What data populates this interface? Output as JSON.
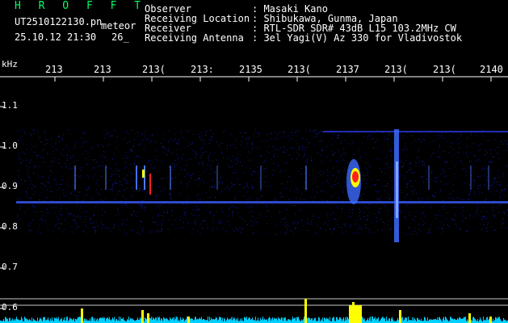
{
  "header": {
    "title": "H R O F F T",
    "filename": "UT2510122130.pn",
    "tag": "meteor",
    "datetime": "25.10.12 21:30",
    "extra": "26_",
    "rows": [
      {
        "key": "Observer",
        "value": ": Masaki Kano"
      },
      {
        "key": "Receiving Location",
        "value": ": Shibukawa, Gunma, Japan"
      },
      {
        "key": "Receiver",
        "value": ": RTL-SDR SDR# 43dB L15 103.2MHz CW"
      },
      {
        "key": "Receiving Antenna",
        "value": ": 3el Yagi(V) Az 330 for Vladivostok"
      }
    ]
  },
  "axes": {
    "y_unit": "kHz",
    "y_ticks": [
      "1.1",
      "1.0",
      "0.9",
      "0.8",
      "0.7",
      "0.6"
    ],
    "x_ticks": [
      "213",
      "213",
      "213(",
      "213:",
      "2135",
      "213(",
      "2137",
      "213(",
      "213(",
      "2140"
    ]
  },
  "colors": {
    "background": "#000000",
    "title": "#00ff66",
    "text": "#ffffff",
    "noise": "#1a2aff",
    "echo_core": "#ff2020",
    "echo_mid": "#ffff00",
    "strip": "#00cfff"
  }
}
